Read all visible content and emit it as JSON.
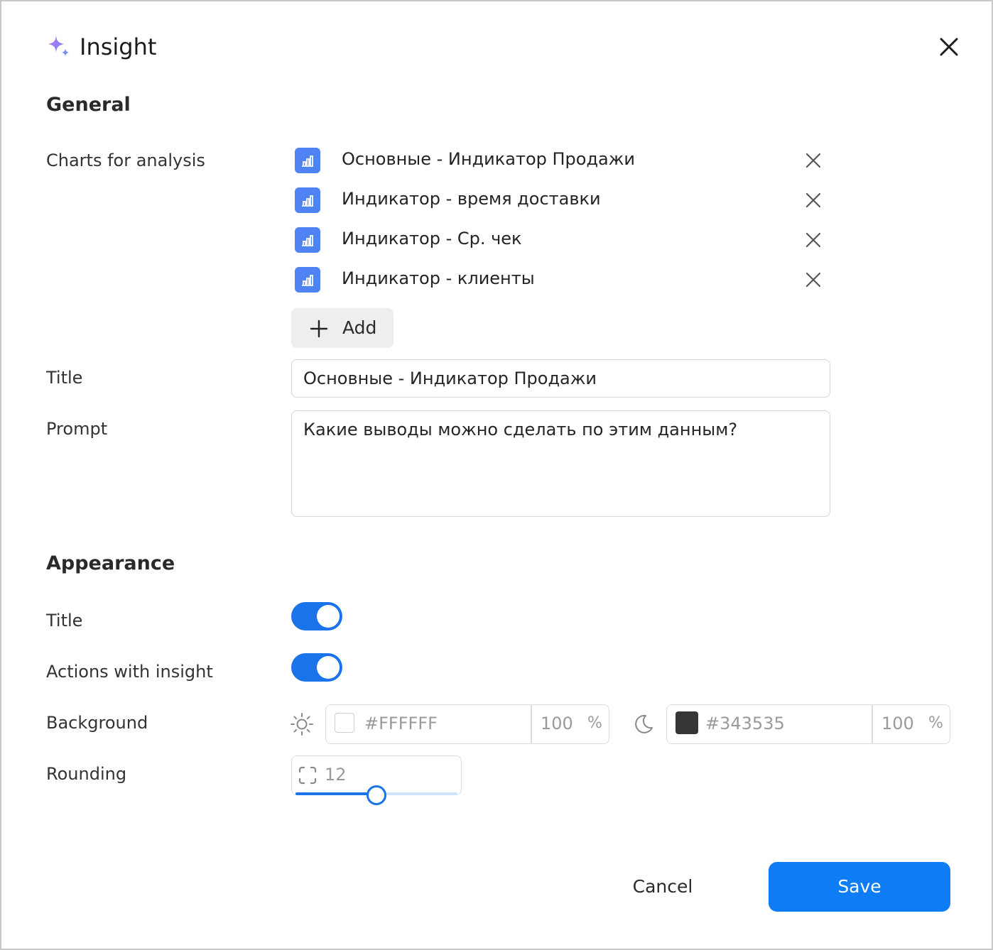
{
  "header": {
    "title": "Insight",
    "icon": "sparkle-icon",
    "close_icon": "close-icon"
  },
  "general": {
    "section_title": "General",
    "charts_label": "Charts for analysis",
    "charts": [
      {
        "label": "Основные - Индикатор Продажи"
      },
      {
        "label": "Индикатор - время доставки"
      },
      {
        "label": "Индикатор - Ср. чек"
      },
      {
        "label": "Индикатор - клиенты"
      }
    ],
    "add_label": "Add",
    "title_label": "Title",
    "title_value": "Основные - Индикатор Продажи",
    "prompt_label": "Prompt",
    "prompt_value": "Какие выводы можно сделать по этим данным?"
  },
  "appearance": {
    "section_title": "Appearance",
    "title_toggle_label": "Title",
    "title_toggle_on": true,
    "actions_toggle_label": "Actions with insight",
    "actions_toggle_on": true,
    "background_label": "Background",
    "light": {
      "hex": "#FFFFFF",
      "opacity": "100",
      "unit": "%"
    },
    "dark": {
      "hex": "#343535",
      "opacity": "100",
      "unit": "%"
    },
    "rounding_label": "Rounding",
    "rounding_value": "12"
  },
  "footer": {
    "cancel_label": "Cancel",
    "save_label": "Save"
  },
  "colors": {
    "accent": "#0d7cf5",
    "chart_icon_bg": "#4f82f3",
    "sparkle": "#a77bf3"
  }
}
